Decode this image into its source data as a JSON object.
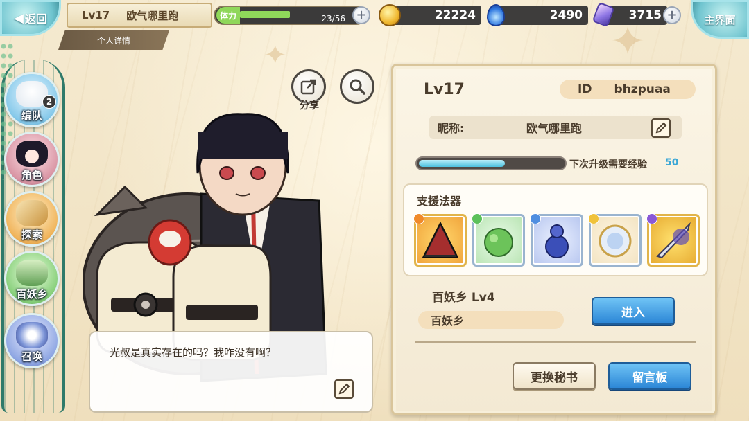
{
  "header": {
    "back_label": "返回",
    "home_label": "主界面",
    "player_level": "Lv17",
    "player_name": "欧气哪里跑",
    "detail_tab": "个人详情",
    "stamina_label": "体力",
    "stamina_value": "23/56",
    "stamina_fraction": 0.41,
    "gold": "22224",
    "flame_currency": "2490",
    "gem_currency": "3715"
  },
  "sidebar": {
    "items": [
      {
        "label": "编队",
        "badge": "2"
      },
      {
        "label": "角色"
      },
      {
        "label": "探索"
      },
      {
        "label": "百妖乡"
      },
      {
        "label": "召唤"
      }
    ]
  },
  "actions": {
    "share_label": "分享"
  },
  "dialog": {
    "text": "光叔是真实存在的吗？我咋没有啊？"
  },
  "profile": {
    "level": "Lv17",
    "id_label": "ID",
    "id_value": "bhzpuaa",
    "nickname_label": "昵称:",
    "nickname": "欧气哪里跑",
    "exp_fraction": 0.6,
    "exp_text": "下次升级需要经验",
    "exp_value": "50",
    "artifacts_title": "支援法器",
    "village_title": "百妖乡   Lv4",
    "village_tag": "百妖乡",
    "enter_button": "进入",
    "change_secretary_button": "更换秘书",
    "message_board_button": "留言板"
  },
  "colors": {
    "accent_blue": "#2b86d6",
    "panel_bg": "#fbf5e6",
    "teal_frame": "#2f7a6a",
    "stamina_green": "#8fd75a",
    "exp_cyan": "#3aa7d6"
  }
}
